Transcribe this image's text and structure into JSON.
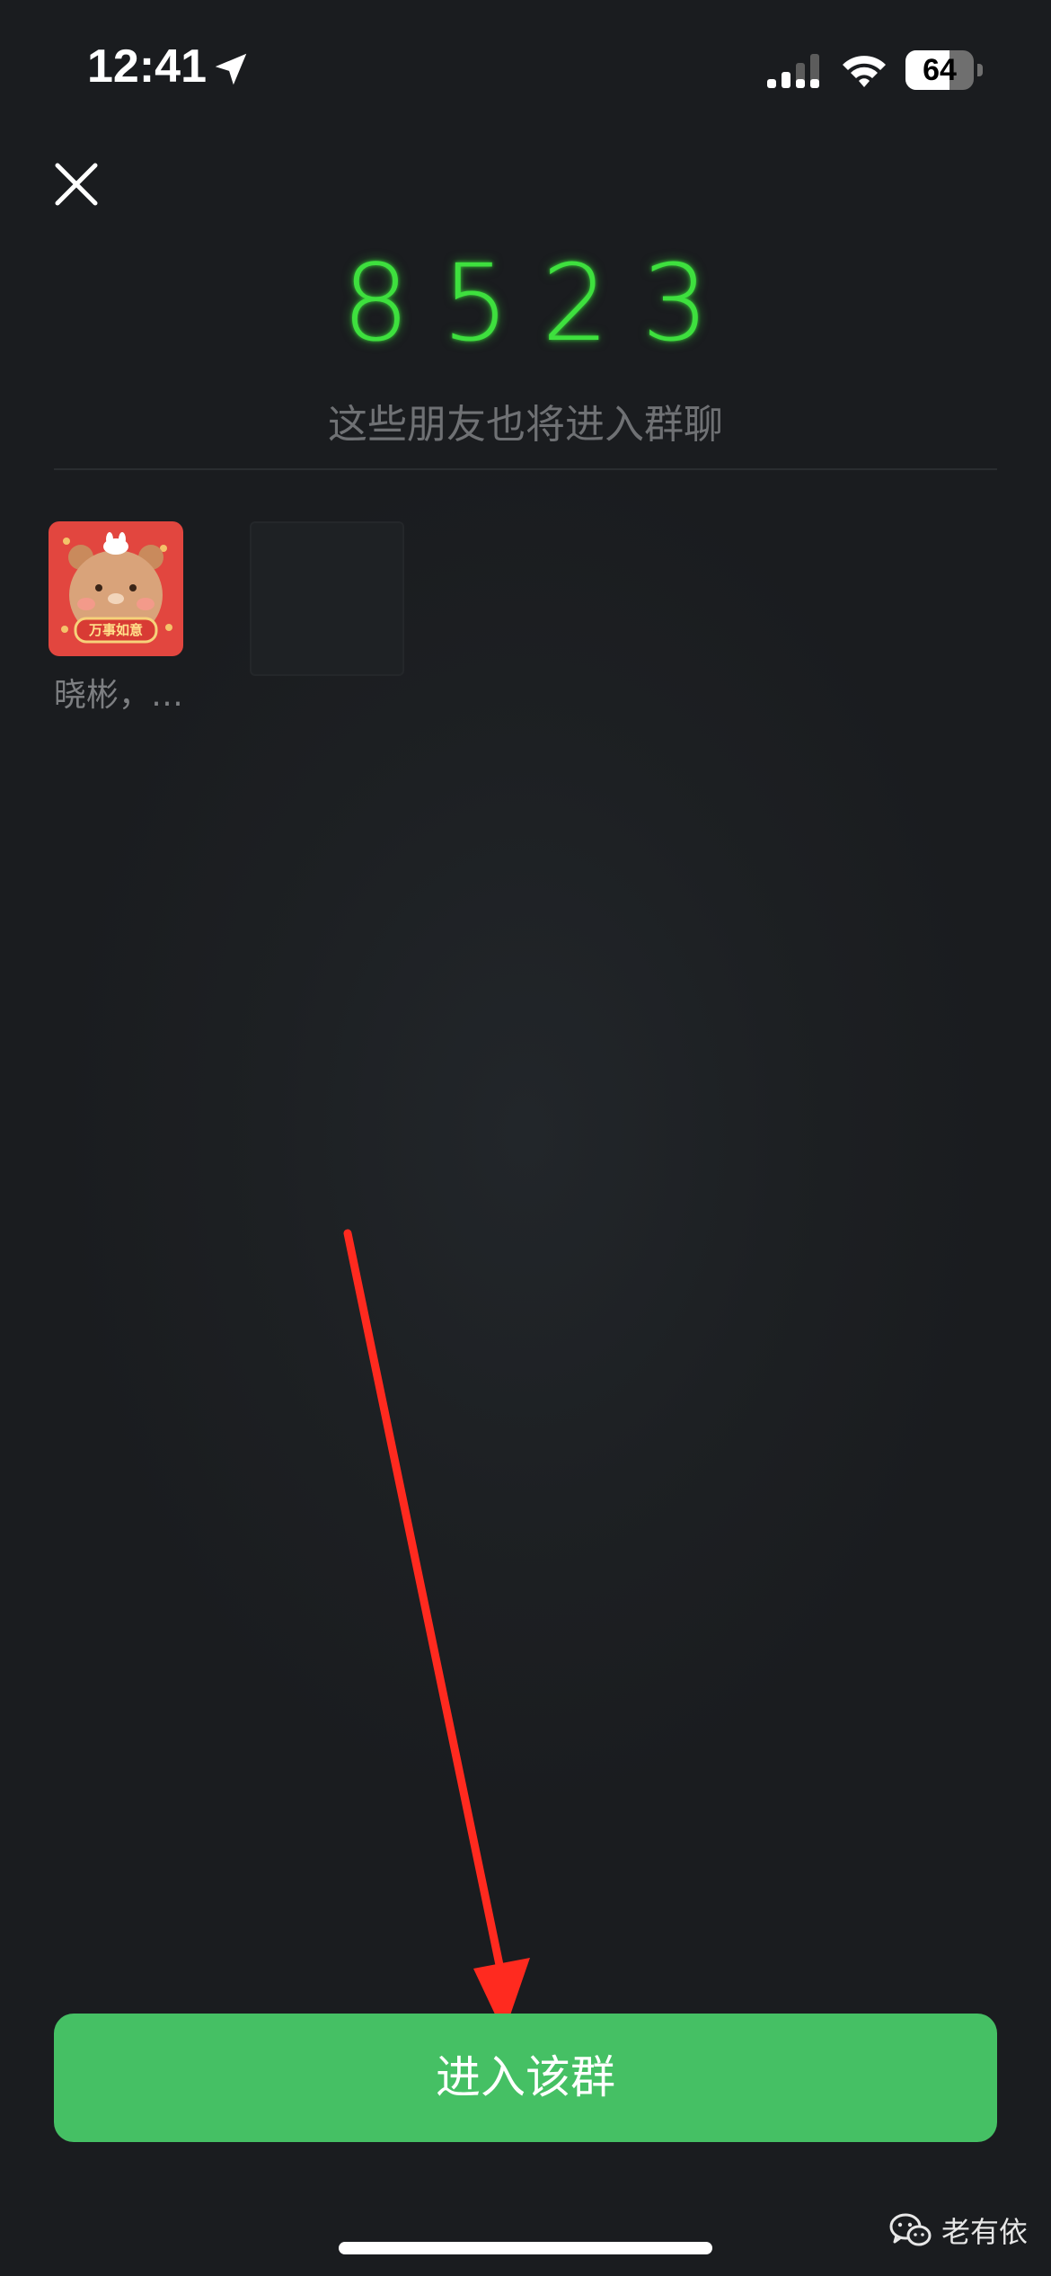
{
  "status_bar": {
    "time": "12:41",
    "battery_level": "64",
    "battery_fraction": 0.64,
    "signal_icon": "cellular-signal-icon",
    "wifi_icon": "wifi-icon",
    "location_icon": "location-arrow-icon"
  },
  "header": {
    "close_icon": "close-icon"
  },
  "group_code": "8523",
  "subtitle": "这些朋友也将进入群聊",
  "members": [
    {
      "name": "晓彬，…",
      "avatar_text": "万事如意"
    }
  ],
  "join_button": {
    "label": "进入该群"
  },
  "watermark": {
    "text": "老有依",
    "icon": "wechat-icon"
  },
  "colors": {
    "background": "#1b1d20",
    "code_green": "#3ee03e",
    "button_green": "#45c064",
    "annotation_red": "#ff2a1f"
  }
}
